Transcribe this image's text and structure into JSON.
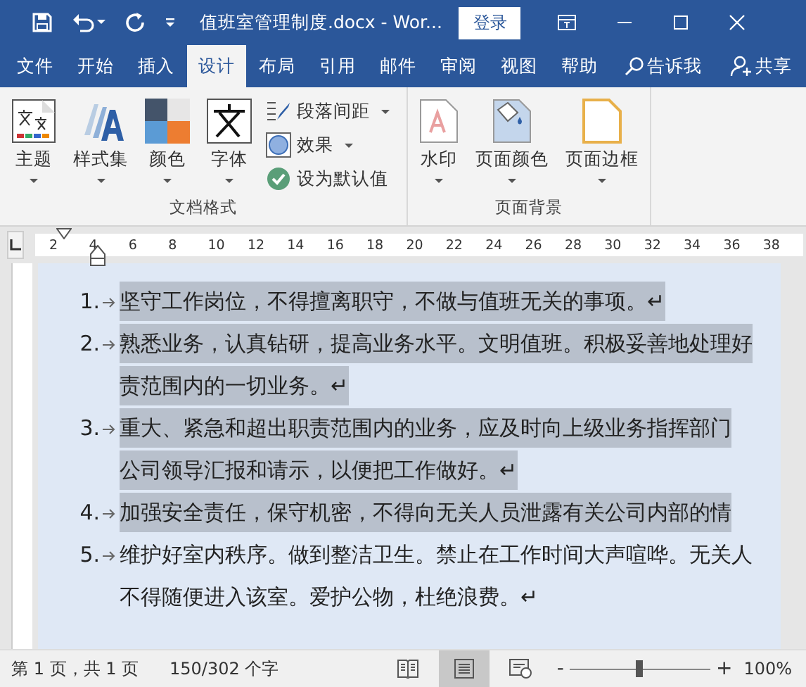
{
  "window": {
    "title": "值班室管理制度.docx  -  Wor...",
    "login": "登录"
  },
  "tabs": [
    {
      "label": "文件",
      "selected": false
    },
    {
      "label": "开始",
      "selected": false
    },
    {
      "label": "插入",
      "selected": false
    },
    {
      "label": "设计",
      "selected": true
    },
    {
      "label": "布局",
      "selected": false
    },
    {
      "label": "引用",
      "selected": false
    },
    {
      "label": "邮件",
      "selected": false
    },
    {
      "label": "审阅",
      "selected": false
    },
    {
      "label": "视图",
      "selected": false
    },
    {
      "label": "帮助",
      "selected": false
    }
  ],
  "tell_me": "告诉我",
  "share": "共享",
  "ribbon": {
    "groups": [
      {
        "label": "文档格式",
        "large": [
          {
            "label": "主题",
            "kind": "theme"
          },
          {
            "label": "样式集",
            "kind": "styles"
          },
          {
            "label": "颜色",
            "kind": "colors"
          },
          {
            "label": "字体",
            "kind": "fonts"
          }
        ],
        "small": [
          {
            "label": "段落间距",
            "kind": "spacing",
            "dropdown": true
          },
          {
            "label": "效果",
            "kind": "effects",
            "dropdown": true
          },
          {
            "label": "设为默认值",
            "kind": "default",
            "dropdown": false
          }
        ]
      },
      {
        "label": "页面背景",
        "large": [
          {
            "label": "水印",
            "kind": "watermark"
          },
          {
            "label": "页面颜色",
            "kind": "pagecolor"
          },
          {
            "label": "页面边框",
            "kind": "border"
          }
        ]
      }
    ]
  },
  "ruler": [
    "2",
    "4",
    "6",
    "8",
    "10",
    "12",
    "14",
    "16",
    "18",
    "20",
    "22",
    "24",
    "26",
    "28",
    "30",
    "32",
    "34",
    "36",
    "38"
  ],
  "paragraphs": [
    {
      "number": "1.",
      "selected": true,
      "lines": [
        "坚守工作岗位，不得擅离职守，不做与值班无关的事项。↵"
      ]
    },
    {
      "number": "2.",
      "selected": true,
      "lines": [
        "熟悉业务，认真钻研，提高业务水平。文明值班。积极妥善地处理好",
        "责范围内的一切业务。↵"
      ]
    },
    {
      "number": "3.",
      "selected": true,
      "lines": [
        "重大、紧急和超出职责范围内的业务，应及时向上级业务指挥部门",
        "公司领导汇报和请示，以便把工作做好。↵"
      ]
    },
    {
      "number": "4.",
      "selected": true,
      "lines": [
        "加强安全责任，保守机密，不得向无关人员泄露有关公司内部的情"
      ]
    },
    {
      "number": "5.",
      "selected": false,
      "lines": [
        "维护好室内秩序。做到整洁卫生。禁止在工作时间大声喧哗。无关人",
        "不得随便进入该室。爱护公物，杜绝浪费。↵"
      ]
    }
  ],
  "status": {
    "page": "第 1 页，共 1 页",
    "words": "150/302 个字",
    "views": [
      {
        "kind": "read",
        "selected": false
      },
      {
        "kind": "print",
        "selected": true
      },
      {
        "kind": "web",
        "selected": false
      }
    ],
    "zoom_minus": "-",
    "zoom_plus": "+",
    "zoom": {
      "level": 0.5
    },
    "zoom_text": "100%"
  }
}
